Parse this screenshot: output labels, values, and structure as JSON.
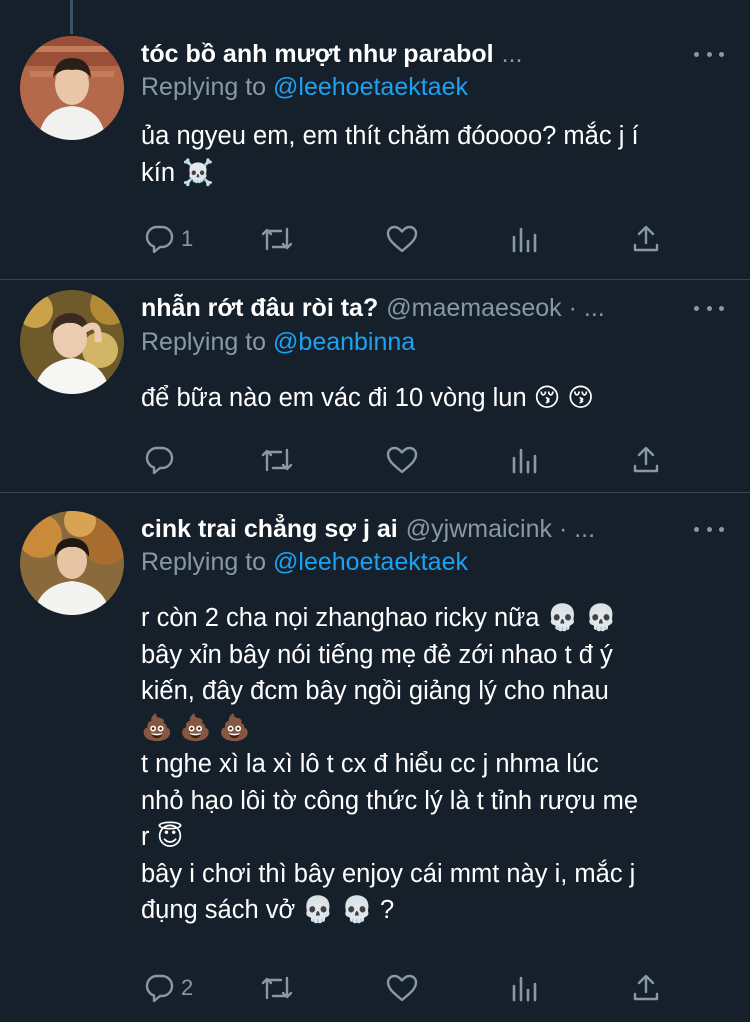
{
  "tweets": [
    {
      "name": "tóc bồ anh mượt như parabol",
      "handle": "...",
      "replying_prefix": "Replying to",
      "replying_to": "@leehoetaektaek",
      "lines": [
        "ủa ngyeu em, em thít chăm đóoooo? mắc j í",
        "kín ☠️"
      ],
      "reply_count": "1",
      "retweet_count": "",
      "like_count": ""
    },
    {
      "name": "nhẫn rớt đâu ròi ta?",
      "handle": "@maemaeseok · ...",
      "replying_prefix": "Replying to",
      "replying_to": "@beanbinna",
      "lines": [
        "để bữa nào em vác đi 10 vòng lun 😚 😚"
      ],
      "reply_count": "",
      "retweet_count": "",
      "like_count": ""
    },
    {
      "name": "cink trai chẳng sợ j ai",
      "handle": "@yjwmaicink · ...",
      "replying_prefix": "Replying to",
      "replying_to": "@leehoetaektaek",
      "lines": [
        "r còn 2 cha nọi zhanghao ricky nữa 💀 💀",
        "bây xỉn bây nói tiếng mẹ đẻ zới nhao t đ ý",
        "kiến, đây đcm bây ngồi giảng lý cho nhau",
        "💩 💩 💩",
        "t nghe xì la xì lô t cx đ hiểu cc j nhma lúc",
        "nhỏ hạo lôi tờ công thức lý là t tỉnh rượu mẹ",
        "r 😇",
        "bây i chơi thì bây enjoy cái mmt này i, mắc j",
        "đụng sách vở 💀 💀 ?"
      ],
      "reply_count": "2",
      "retweet_count": "",
      "like_count": ""
    }
  ],
  "icons": {
    "reply": "reply-icon",
    "retweet": "retweet-icon",
    "like": "heart-icon",
    "views": "views-icon",
    "share": "share-icon",
    "more": "more-icon"
  },
  "colors": {
    "background": "#15202b",
    "secondary_text": "#8899a6",
    "mention": "#1da1f2",
    "divider": "#38444d",
    "thread_line": "#3d5466"
  }
}
